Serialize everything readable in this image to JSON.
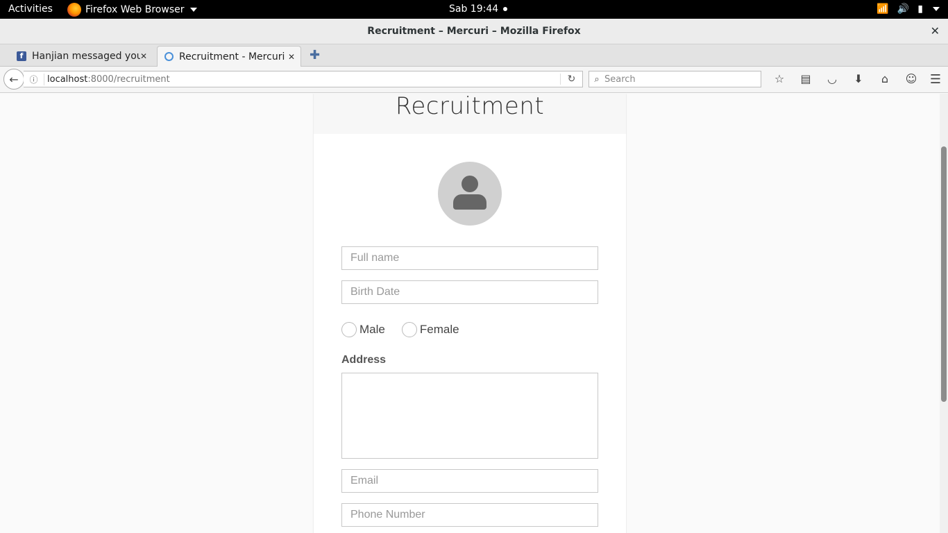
{
  "topbar": {
    "activities": "Activities",
    "app_menu": "Firefox Web Browser",
    "clock": "Sab 19:44"
  },
  "window": {
    "title": "Recruitment – Mercuri – Mozilla Firefox"
  },
  "tabs": [
    {
      "label": "Hanjian messaged you",
      "favicon": "facebook-icon",
      "active": false
    },
    {
      "label": "Recruitment - Mercuri",
      "favicon": "loading-ring-icon",
      "active": true
    }
  ],
  "navbar": {
    "url_host": "localhost",
    "url_path": ":8000/recruitment",
    "search_placeholder": "Search"
  },
  "page": {
    "heading": "Recruitment",
    "fields": {
      "full_name_placeholder": "Full name",
      "birth_date_placeholder": "Birth Date",
      "email_placeholder": "Email",
      "phone_placeholder": "Phone Number"
    },
    "gender": {
      "male": "Male",
      "female": "Female"
    },
    "address_label": "Address"
  }
}
